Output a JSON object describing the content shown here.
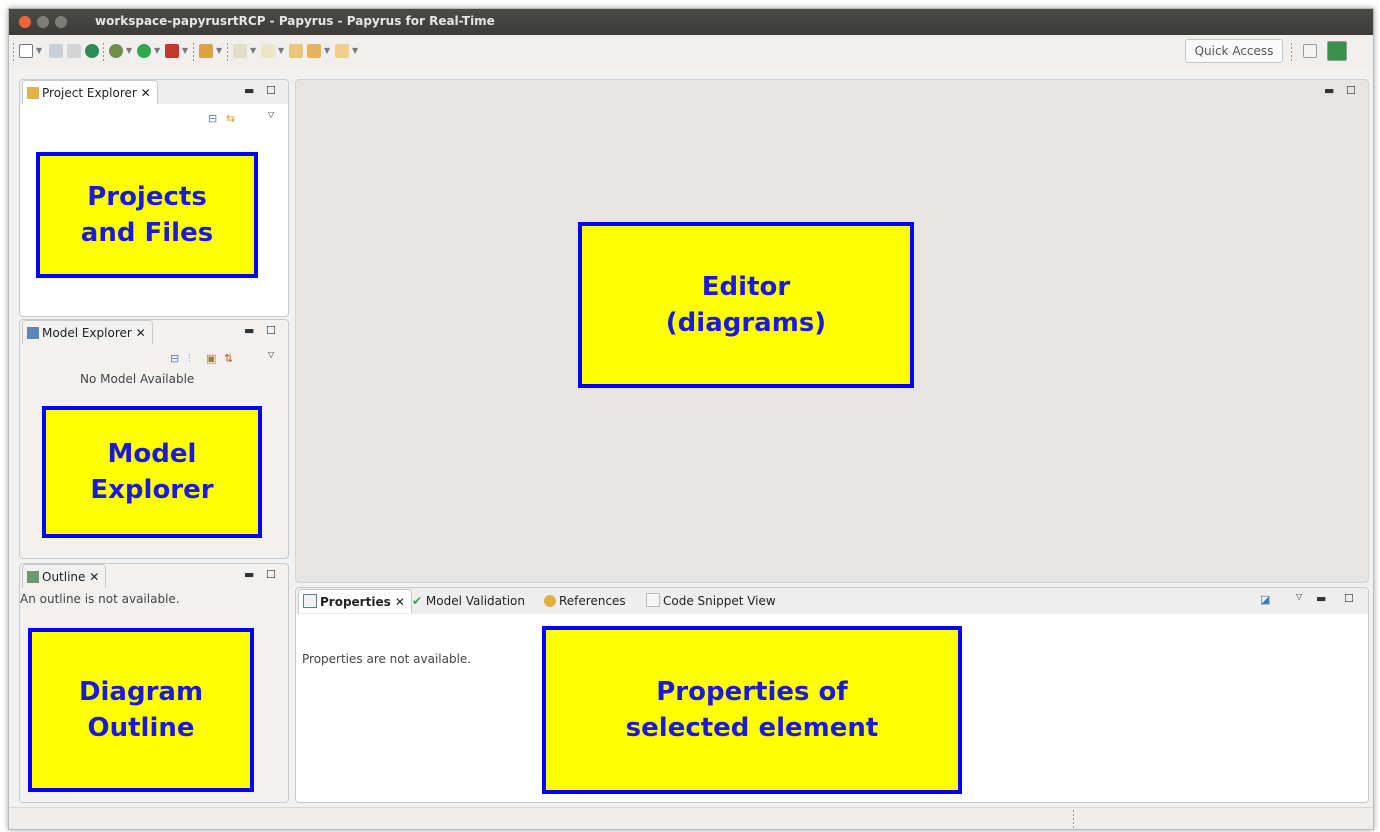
{
  "window": {
    "title": "workspace-papyrusrtRCP - Papyrus - Papyrus for Real-Time"
  },
  "toolbar": {
    "quick_access": "Quick Access"
  },
  "project_explorer": {
    "tab": "Project Explorer",
    "callout": "Projects\nand Files"
  },
  "model_explorer": {
    "tab": "Model Explorer",
    "empty_text": "No Model Available",
    "callout": "Model\nExplorer"
  },
  "outline": {
    "tab": "Outline",
    "empty_text": "An outline is not available.",
    "callout": "Diagram\nOutline"
  },
  "editor": {
    "callout": "Editor\n(diagrams)"
  },
  "bottom": {
    "tabs": [
      "Properties",
      "Model Validation",
      "References",
      "Code Snippet View"
    ],
    "empty_text": "Properties are not available.",
    "callout": "Properties of\nselected element"
  },
  "colors": {
    "callout_fill": "#ffff00",
    "callout_border": "#0000ff",
    "callout_text": "#1a1ad8",
    "titlebar": "#3c3b37",
    "close_button": "#f0663a"
  }
}
